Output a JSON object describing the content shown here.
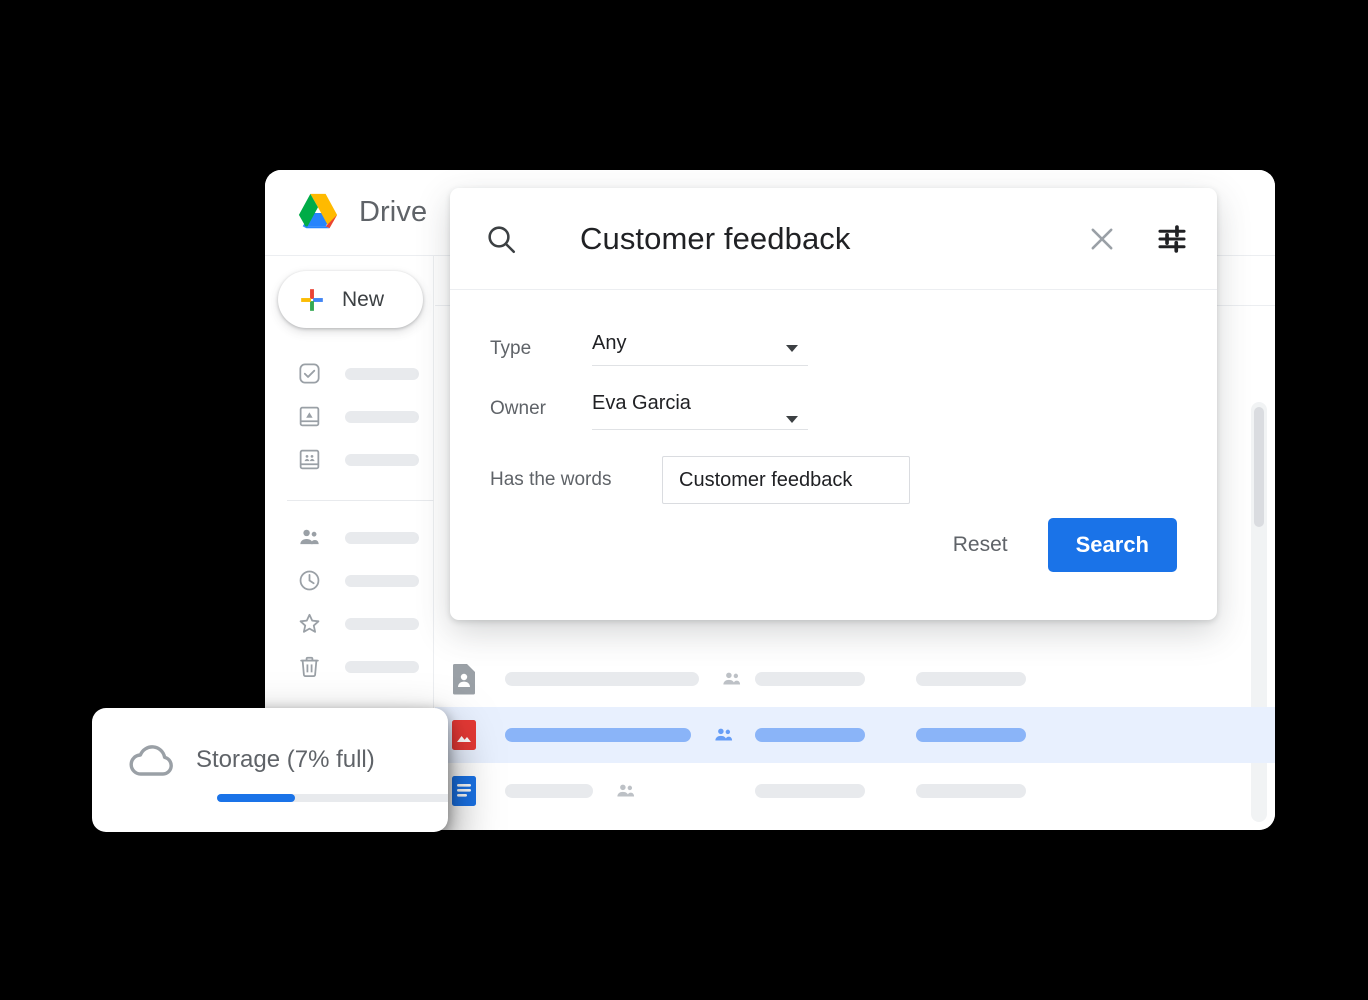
{
  "app": {
    "title": "Drive",
    "logo_icon": "google-drive-logo"
  },
  "sidebar": {
    "new_button": {
      "label": "New",
      "icon": "google-plus-icon"
    },
    "groups": [
      {
        "items": [
          {
            "icon": "check-circle-icon",
            "label": ""
          },
          {
            "icon": "drive-box-icon",
            "label": ""
          },
          {
            "icon": "shared-drives-icon",
            "label": ""
          }
        ]
      },
      {
        "items": [
          {
            "icon": "people-icon",
            "label": ""
          },
          {
            "icon": "clock-icon",
            "label": ""
          },
          {
            "icon": "star-icon",
            "label": ""
          },
          {
            "icon": "trash-icon",
            "label": ""
          }
        ]
      }
    ]
  },
  "search_dialog": {
    "search_icon": "search-icon",
    "query": "Customer feedback",
    "close_icon": "close-icon",
    "tune_icon": "tune-icon",
    "fields": [
      {
        "label": "Type",
        "value": "Any",
        "control": "select"
      },
      {
        "label": "Owner",
        "value": "Eva Garcia",
        "control": "select"
      },
      {
        "label": "Has the words",
        "value": "Customer feedback",
        "control": "text"
      }
    ],
    "reset_label": "Reset",
    "search_label": "Search",
    "accent_color": "#1a73e8"
  },
  "file_list": {
    "rows": [
      {
        "icon": "shared-folder-icon",
        "icon_color": "#9aa0a6",
        "selected": false,
        "shared_icon": "people-icon"
      },
      {
        "icon": "image-file-icon",
        "icon_color": "#e53935",
        "selected": true,
        "shared_icon": "people-icon"
      },
      {
        "icon": "doc-file-icon",
        "icon_color": "#1a73e8",
        "selected": false,
        "shared_icon": "people-icon"
      }
    ],
    "selected_row_color": "#e8f0fe"
  },
  "storage_card": {
    "icon": "cloud-icon",
    "label": "Storage (7% full)",
    "percent_full": 7,
    "bar_color": "#1a73e8"
  }
}
